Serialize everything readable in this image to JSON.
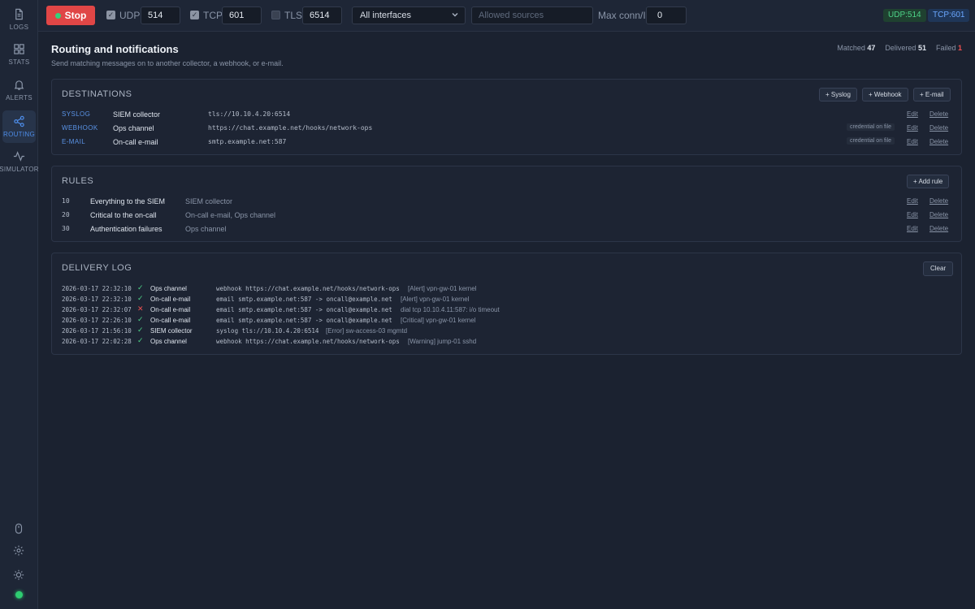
{
  "nav": {
    "items": [
      {
        "label": "LOGS",
        "icon": "file-icon"
      },
      {
        "label": "STATS",
        "icon": "grid-icon"
      },
      {
        "label": "ALERTS",
        "icon": "bell-icon"
      },
      {
        "label": "ROUTING",
        "icon": "share-icon",
        "active": true
      },
      {
        "label": "SIMULATOR",
        "icon": "pulse-icon"
      }
    ],
    "bottom_icons": [
      "mouse-icon",
      "gear-icon",
      "sun-icon",
      "status-dot"
    ]
  },
  "topbar": {
    "stop_label": "Stop",
    "udp": {
      "label": "UDP",
      "checked": true,
      "port": "514"
    },
    "tcp": {
      "label": "TCP",
      "checked": true,
      "port": "601"
    },
    "tls": {
      "label": "TLS",
      "checked": false,
      "port": "6514"
    },
    "interface": "All interfaces",
    "allowed_sources_placeholder": "Allowed sources",
    "max_conn_label": "Max conn/IP",
    "max_conn_value": "0",
    "badges": {
      "udp": "UDP:514",
      "tcp": "TCP:601"
    },
    "colors": {
      "stop": "#e04646",
      "udp_badge": "#4ed488",
      "tcp_badge": "#6aa7ff"
    }
  },
  "page": {
    "title": "Routing and notifications",
    "subtitle": "Send matching messages on to another collector, a webhook, or e-mail.",
    "stats": {
      "matched_label": "Matched",
      "matched": "47",
      "delivered_label": "Delivered",
      "delivered": "51",
      "failed_label": "Failed",
      "failed": "1"
    }
  },
  "destinations": {
    "title": "DESTINATIONS",
    "buttons": [
      "+ Syslog",
      "+ Webhook",
      "+ E-mail"
    ],
    "rows": [
      {
        "kind": "SYSLOG",
        "name": "SIEM collector",
        "target": "tls://10.10.4.20:6514",
        "cred": "",
        "edit": "Edit",
        "delete": "Delete"
      },
      {
        "kind": "WEBHOOK",
        "name": "Ops channel",
        "target": "https://chat.example.net/hooks/network-ops",
        "cred": "credential on file",
        "edit": "Edit",
        "delete": "Delete"
      },
      {
        "kind": "E-MAIL",
        "name": "On-call e-mail",
        "target": "smtp.example.net:587",
        "cred": "credential on file",
        "edit": "Edit",
        "delete": "Delete"
      }
    ]
  },
  "rules": {
    "title": "RULES",
    "add_label": "+ Add rule",
    "rows": [
      {
        "order": "10",
        "name": "Everything to the SIEM",
        "dest": "SIEM collector",
        "edit": "Edit",
        "delete": "Delete"
      },
      {
        "order": "20",
        "name": "Critical to the on-call",
        "dest": "On-call e-mail, Ops channel",
        "edit": "Edit",
        "delete": "Delete"
      },
      {
        "order": "30",
        "name": "Authentication failures",
        "dest": "Ops channel",
        "edit": "Edit",
        "delete": "Delete"
      }
    ]
  },
  "delivery_log": {
    "title": "DELIVERY LOG",
    "clear_label": "Clear",
    "rows": [
      {
        "time": "2026-03-17 22:32:10",
        "status": "✓",
        "ok": true,
        "dest": "Ops channel",
        "detail": "webhook https://chat.example.net/hooks/network-ops",
        "msg": "[Alert] vpn-gw-01 kernel"
      },
      {
        "time": "2026-03-17 22:32:10",
        "status": "✓",
        "ok": true,
        "dest": "On-call e-mail",
        "detail": "email smtp.example.net:587 -> oncall@example.net",
        "msg": "[Alert] vpn-gw-01 kernel"
      },
      {
        "time": "2026-03-17 22:32:07",
        "status": "✕",
        "ok": false,
        "dest": "On-call e-mail",
        "detail": "email smtp.example.net:587 -> oncall@example.net",
        "msg": "dial tcp 10.10.4.11:587: i/o timeout"
      },
      {
        "time": "2026-03-17 22:26:10",
        "status": "✓",
        "ok": true,
        "dest": "On-call e-mail",
        "detail": "email smtp.example.net:587 -> oncall@example.net",
        "msg": "[Critical] vpn-gw-01 kernel"
      },
      {
        "time": "2026-03-17 21:56:10",
        "status": "✓",
        "ok": true,
        "dest": "SIEM collector",
        "detail": "syslog tls://10.10.4.20:6514",
        "msg": "[Error] sw-access-03 mgmtd"
      },
      {
        "time": "2026-03-17 22:02:28",
        "status": "✓",
        "ok": true,
        "dest": "Ops channel",
        "detail": "webhook https://chat.example.net/hooks/network-ops",
        "msg": "[Warning] jump-01 sshd"
      }
    ]
  }
}
